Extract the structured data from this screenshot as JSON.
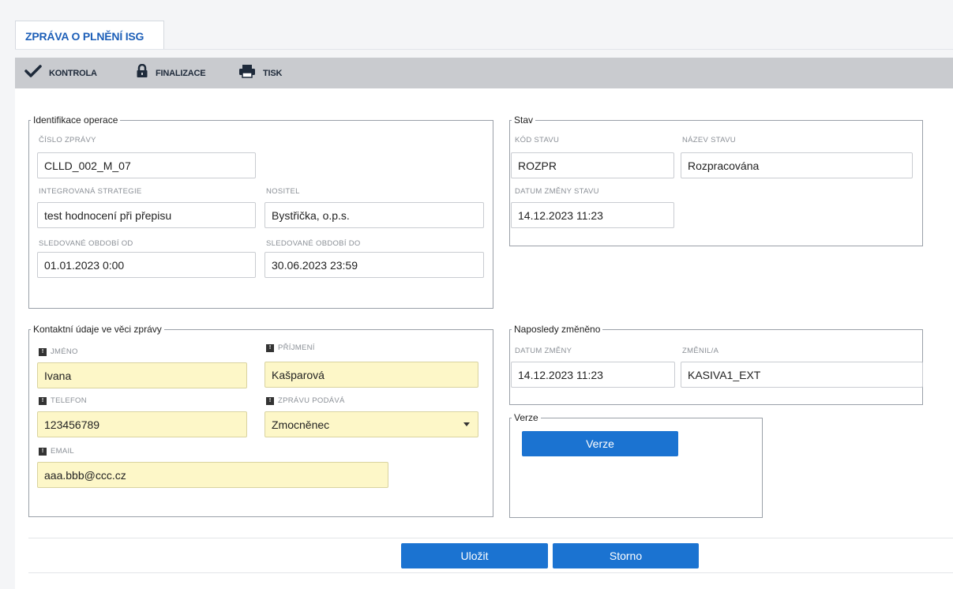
{
  "tab": {
    "title": "ZPRÁVA O PLNĚNÍ ISG"
  },
  "toolbar": {
    "items": [
      {
        "label": "KONTROLA",
        "icon": "checkmark-icon"
      },
      {
        "label": "FINALIZACE",
        "icon": "lock-icon"
      },
      {
        "label": "TISK",
        "icon": "printer-icon"
      }
    ]
  },
  "identifikace": {
    "legend": "Identifikace operace",
    "cislo_zpravy": {
      "label": "ČÍSLO ZPRÁVY",
      "value": "CLLD_002_M_07"
    },
    "strategie": {
      "label": "INTEGROVANÁ STRATEGIE",
      "value": "test hodnocení při přepisu"
    },
    "nositel": {
      "label": "NOSITEL",
      "value": "Bystřička, o.p.s."
    },
    "obdobi_od": {
      "label": "SLEDOVANÉ OBDOBÍ OD",
      "value": "01.01.2023 0:00"
    },
    "obdobi_do": {
      "label": "SLEDOVANÉ OBDOBÍ DO",
      "value": "30.06.2023 23:59"
    }
  },
  "stav": {
    "legend": "Stav",
    "kod": {
      "label": "KÓD STAVU",
      "value": "ROZPR"
    },
    "nazev": {
      "label": "NÁZEV STAVU",
      "value": "Rozpracována"
    },
    "datum": {
      "label": "DATUM ZMĚNY STAVU",
      "value": "14.12.2023 11:23"
    }
  },
  "kontakt": {
    "legend": "Kontaktní údaje ve věci zprávy",
    "jmeno": {
      "label": "JMÉNO",
      "value": "Ivana"
    },
    "prijmeni": {
      "label": "PŘÍJMENÍ",
      "value": "Kašparová"
    },
    "telefon": {
      "label": "TELEFON",
      "value": "123456789"
    },
    "podava": {
      "label": "ZPRÁVU PODÁVÁ",
      "value": "Zmocněnec"
    },
    "email": {
      "label": "EMAIL",
      "value": "aaa.bbb@ccc.cz"
    }
  },
  "zmeneno": {
    "legend": "Naposledy změněno",
    "datum": {
      "label": "DATUM ZMĚNY",
      "value": "14.12.2023 11:23"
    },
    "zmenil": {
      "label": "ZMĚNIL/A",
      "value": "KASIVA1_EXT"
    }
  },
  "verze": {
    "legend": "Verze",
    "button": "Verze"
  },
  "footer": {
    "save": "Uložit",
    "cancel": "Storno"
  },
  "colors": {
    "accent": "#1b73d1",
    "tab_text": "#1d5fb8",
    "required_bg": "#fdf7c8",
    "toolbar": "#c9cbcf"
  }
}
